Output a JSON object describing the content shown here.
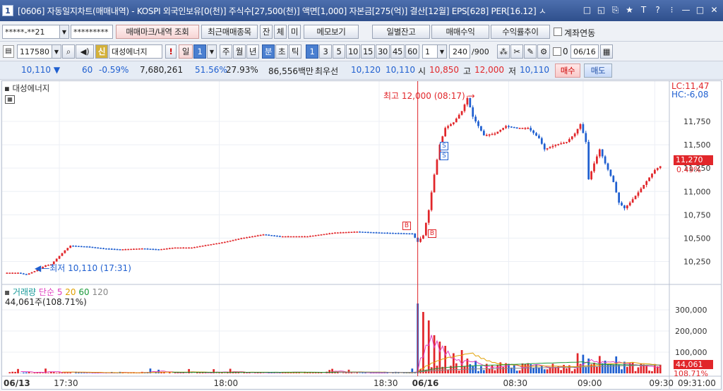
{
  "window": {
    "number": "1",
    "title": "[0606] 자동일지차트(매매내역) - KOSPI 외국인보유[0(천)] 주식수[27,500(천)] 액면[1,000] 자본금[275(억)] 결산[12월] EPS[628] PER[16.12] ㅅ",
    "controls": [
      "□",
      "◱",
      "⎘",
      "★",
      "T",
      "?",
      "⁝",
      "—",
      "□",
      "✕"
    ]
  },
  "toolbar1": {
    "account": "*****-**21",
    "password": "*********",
    "btn_trade_mark": "매매마크/내역 조회",
    "btn_recent": "최근매매종목",
    "btn_jan": "잔",
    "btn_che": "체",
    "btn_mi": "미",
    "btn_memo": "메모보기",
    "btn_daily": "일별잔고",
    "btn_profit": "매매수익",
    "btn_return": "수익률추이",
    "chk_link": "계좌연동"
  },
  "toolbar2": {
    "code": "117580",
    "stock_name": "대성에너지",
    "period_btn": "일",
    "period_num": "1",
    "periods": [
      "주",
      "월",
      "년",
      "분",
      "초",
      "틱"
    ],
    "minute_nums": [
      "1",
      "3",
      "5",
      "10",
      "15",
      "30",
      "45",
      "60"
    ],
    "interval": "1",
    "count": "240",
    "count_total": "/900",
    "date_prefix": "0",
    "date": "06/16"
  },
  "quote": {
    "price": "10,110",
    "change": "60",
    "rate": "-0.59%",
    "volume": "7,680,261",
    "vol_rate": "51.56%",
    "turnover": "27.93%",
    "amount": "86,556백만",
    "best_label": "최우선",
    "ask": "10,120",
    "bid": "10,110",
    "open_label": "시",
    "open": "10,850",
    "high_label": "고",
    "high": "12,000",
    "low_label": "저",
    "low": "10,110",
    "buy_btn": "매수",
    "sell_btn": "매도"
  },
  "chart": {
    "stock_label": "대성에너지",
    "lc": "LC:11,47",
    "hc": "HC:-6,08",
    "high_annot": "최고 12,000 (08:17)",
    "low_annot": "최저 10,110 (17:31)",
    "price_badge": "11,270",
    "price_badge_rate": "0.49%",
    "vol_legend_title": "거래량",
    "vol_legend_ma": "단순",
    "vol_ma": [
      "5",
      "20",
      "60",
      "120"
    ],
    "vol_value": "44,061주(108.71%)",
    "vol_badge": "44,061",
    "vol_badge_rate": "108.71%"
  },
  "chart_data": {
    "type": "candlestick",
    "price_axis": [
      "11,750",
      "11,500",
      "11,250",
      "11,000",
      "10,750",
      "10,500",
      "10,250"
    ],
    "price_ylim": [
      10050,
      12120
    ],
    "volume_axis": [
      "300,000",
      "200,000",
      "100,000"
    ],
    "volume_ylim": [
      0,
      380000
    ],
    "x_labels": [
      "06/13",
      "17:30",
      "18:00",
      "18:30",
      "06/16",
      "08:30",
      "09:00",
      "09:30",
      "09:31:00"
    ],
    "price_path": [
      [
        0,
        10130
      ],
      [
        5,
        10130
      ],
      [
        8,
        10110
      ],
      [
        12,
        10160
      ],
      [
        15,
        10210
      ],
      [
        17,
        10220
      ],
      [
        22,
        10370
      ],
      [
        24,
        10420
      ],
      [
        30,
        10410
      ],
      [
        36,
        10390
      ],
      [
        42,
        10380
      ],
      [
        50,
        10390
      ],
      [
        56,
        10380
      ],
      [
        62,
        10400
      ],
      [
        68,
        10400
      ],
      [
        76,
        10440
      ],
      [
        80,
        10460
      ],
      [
        86,
        10500
      ],
      [
        94,
        10540
      ],
      [
        100,
        10520
      ],
      [
        110,
        10520
      ],
      [
        120,
        10560
      ],
      [
        128,
        10570
      ],
      [
        136,
        10560
      ],
      [
        148,
        10550
      ],
      [
        150,
        10460
      ],
      [
        152,
        10530
      ],
      [
        154,
        10800
      ],
      [
        156,
        11180
      ],
      [
        158,
        11500
      ],
      [
        160,
        11680
      ],
      [
        163,
        11740
      ],
      [
        166,
        11860
      ],
      [
        168,
        12000
      ],
      [
        170,
        11800
      ],
      [
        172,
        11700
      ],
      [
        174,
        11600
      ],
      [
        178,
        11620
      ],
      [
        182,
        11700
      ],
      [
        186,
        11680
      ],
      [
        190,
        11680
      ],
      [
        194,
        11570
      ],
      [
        196,
        11450
      ],
      [
        200,
        11500
      ],
      [
        204,
        11530
      ],
      [
        207,
        11620
      ],
      [
        209,
        11720
      ],
      [
        211,
        11530
      ],
      [
        212,
        11130
      ],
      [
        214,
        11300
      ],
      [
        216,
        11450
      ],
      [
        218,
        11300
      ],
      [
        221,
        11100
      ],
      [
        223,
        10880
      ],
      [
        225,
        10820
      ],
      [
        227,
        10880
      ],
      [
        230,
        10990
      ],
      [
        234,
        11150
      ],
      [
        236,
        11230
      ],
      [
        238,
        11270
      ]
    ],
    "volume_spikes": [
      [
        150,
        330000
      ],
      [
        152,
        290000
      ],
      [
        154,
        250000
      ],
      [
        156,
        180000
      ],
      [
        158,
        150000
      ],
      [
        160,
        130000
      ],
      [
        163,
        95000
      ],
      [
        166,
        110000
      ],
      [
        168,
        70000
      ],
      [
        171,
        60000
      ],
      [
        175,
        45000
      ],
      [
        180,
        52000
      ],
      [
        185,
        40000
      ],
      [
        190,
        48000
      ],
      [
        195,
        35000
      ],
      [
        200,
        30000
      ],
      [
        205,
        38000
      ],
      [
        208,
        95000
      ],
      [
        210,
        88000
      ],
      [
        212,
        70000
      ],
      [
        214,
        50000
      ],
      [
        216,
        82000
      ],
      [
        218,
        60000
      ],
      [
        222,
        80000
      ],
      [
        225,
        55000
      ],
      [
        228,
        50000
      ],
      [
        232,
        42000
      ],
      [
        236,
        44061
      ]
    ]
  },
  "colors": {
    "up": "#e1262a",
    "down": "#1f5fd0",
    "ma5": "#e040c0",
    "ma20": "#e0a000",
    "ma60": "#1a9a3a",
    "ma120": "#888888"
  }
}
